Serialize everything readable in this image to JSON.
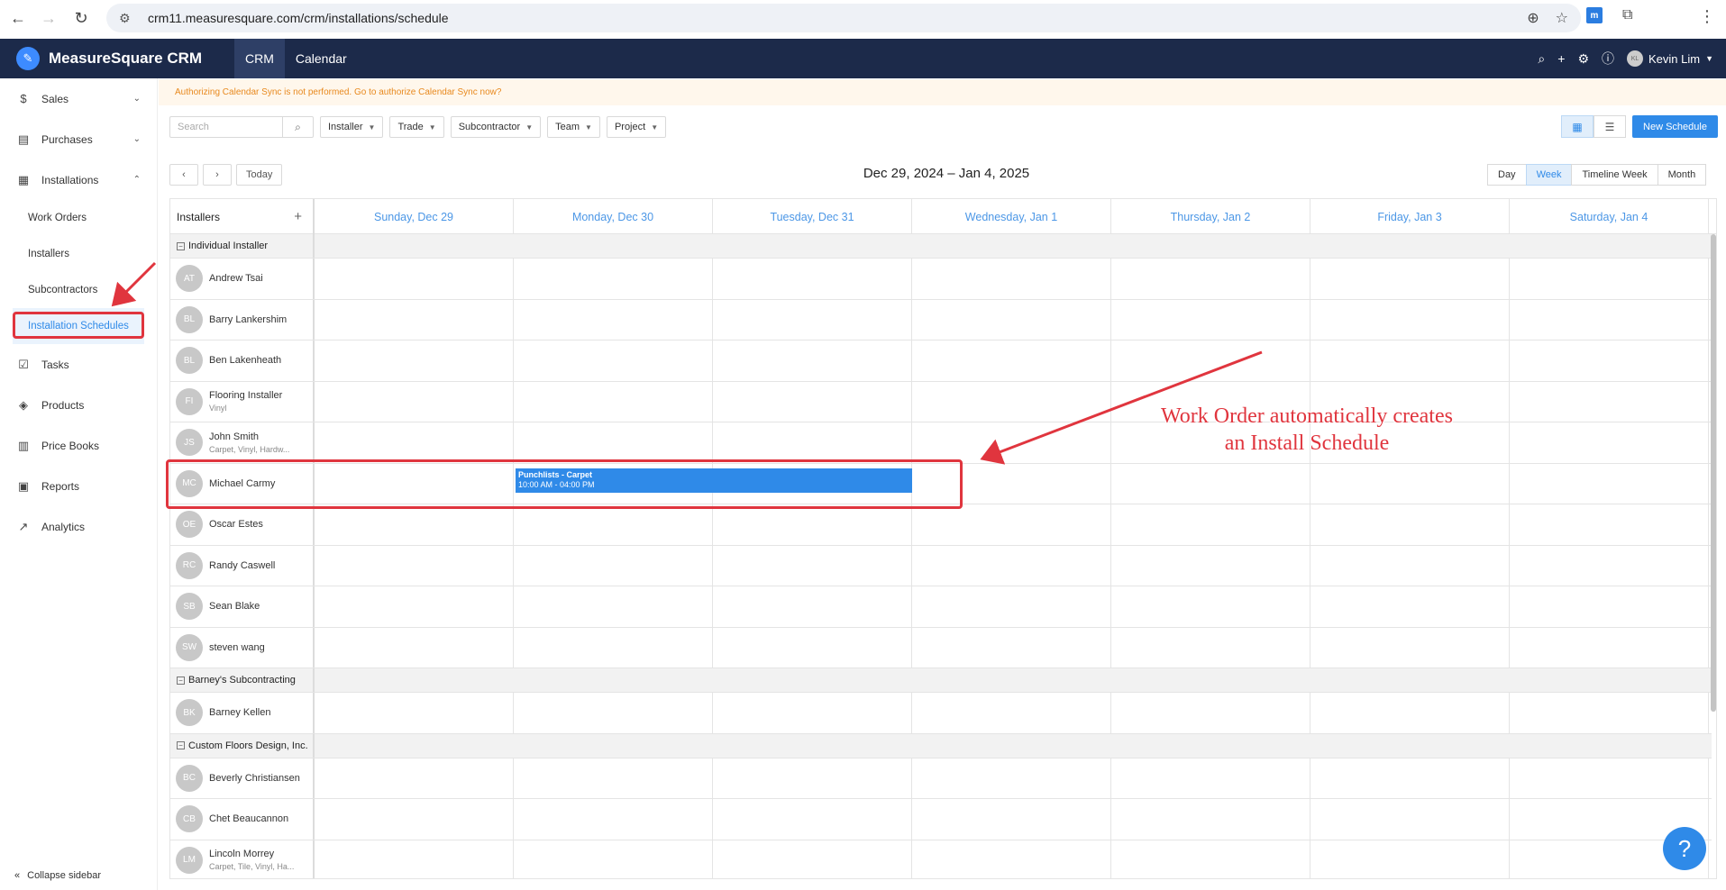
{
  "browser": {
    "url": "crm11.measuresquare.com/crm/installations/schedule"
  },
  "header": {
    "app_name": "MeasureSquare CRM",
    "tabs": [
      {
        "label": "CRM"
      },
      {
        "label": "Calendar"
      }
    ],
    "user_initials": "KL",
    "user_name": "Kevin Lim"
  },
  "sidebar": {
    "items": [
      {
        "label": "Sales",
        "icon": "dollar-icon"
      },
      {
        "label": "Purchases",
        "icon": "purchase-icon"
      },
      {
        "label": "Installations",
        "icon": "installations-icon"
      },
      {
        "label": "Tasks",
        "icon": "calendar-check-icon"
      },
      {
        "label": "Products",
        "icon": "box-icon"
      },
      {
        "label": "Price Books",
        "icon": "book-icon"
      },
      {
        "label": "Reports",
        "icon": "reports-icon"
      },
      {
        "label": "Analytics",
        "icon": "chart-icon"
      }
    ],
    "sub_items": [
      {
        "label": "Work Orders"
      },
      {
        "label": "Installers"
      },
      {
        "label": "Subcontractors"
      },
      {
        "label": "Installation Schedules"
      }
    ],
    "collapse_label": "Collapse sidebar"
  },
  "notice": "Authorizing Calendar Sync is not performed. Go to authorize Calendar Sync now?",
  "toolbar": {
    "search_placeholder": "Search",
    "filters": [
      "Installer",
      "Trade",
      "Subcontractor",
      "Team",
      "Project"
    ],
    "new_schedule": "New Schedule"
  },
  "calendar": {
    "today_label": "Today",
    "range_title": "Dec 29, 2024 – Jan 4, 2025",
    "views": [
      "Day",
      "Week",
      "Timeline Week",
      "Month"
    ],
    "active_view": "Week",
    "resource_header": "Installers",
    "days": [
      "Sunday, Dec 29",
      "Monday, Dec 30",
      "Tuesday, Dec 31",
      "Wednesday, Jan 1",
      "Thursday, Jan 2",
      "Friday, Jan 3",
      "Saturday, Jan 4"
    ],
    "groups": [
      {
        "name": "Individual Installer",
        "people": [
          {
            "initials": "AT",
            "name": "Andrew Tsai",
            "sub": ""
          },
          {
            "initials": "BL",
            "name": "Barry Lankershim",
            "sub": ""
          },
          {
            "initials": "BL",
            "name": "Ben Lakenheath",
            "sub": ""
          },
          {
            "initials": "FI",
            "name": "Flooring Installer",
            "sub": "Vinyl"
          },
          {
            "initials": "JS",
            "name": "John Smith",
            "sub": "Carpet, Vinyl, Hardw..."
          },
          {
            "initials": "MC",
            "name": "Michael Carmy",
            "sub": ""
          },
          {
            "initials": "OE",
            "name": "Oscar Estes",
            "sub": ""
          },
          {
            "initials": "RC",
            "name": "Randy Caswell",
            "sub": ""
          },
          {
            "initials": "SB",
            "name": "Sean Blake",
            "sub": ""
          },
          {
            "initials": "SW",
            "name": "steven wang",
            "sub": ""
          }
        ]
      },
      {
        "name": "Barney's Subcontracting",
        "people": [
          {
            "initials": "BK",
            "name": "Barney Kellen",
            "sub": ""
          }
        ]
      },
      {
        "name": "Custom Floors Design, Inc.",
        "people": [
          {
            "initials": "BC",
            "name": "Beverly Christiansen",
            "sub": ""
          },
          {
            "initials": "CB",
            "name": "Chet Beaucannon",
            "sub": ""
          },
          {
            "initials": "LM",
            "name": "Lincoln Morrey",
            "sub": "Carpet, Tile, Vinyl, Ha..."
          }
        ]
      }
    ],
    "event": {
      "title": "Punchlists - Carpet",
      "time": "10:00 AM - 04:00 PM"
    }
  },
  "annotation": {
    "line1": "Work Order automatically creates",
    "line2": "an Install Schedule",
    "color": "#e0353e"
  },
  "help_label": "?"
}
